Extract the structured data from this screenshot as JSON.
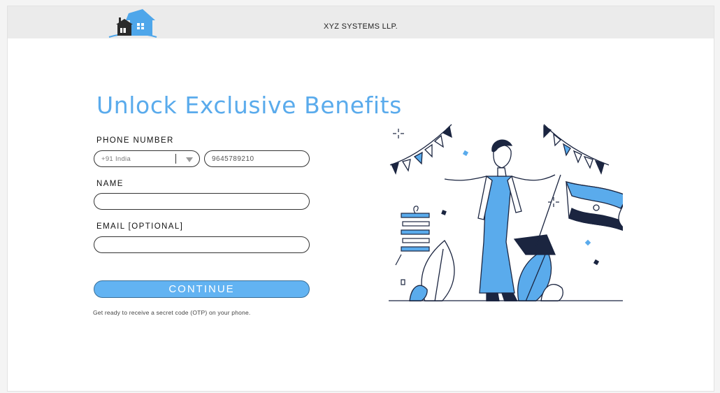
{
  "header": {
    "company_name": "XYZ SYSTEMS LLP.",
    "logo_icon": "house-logo-icon"
  },
  "form": {
    "title": "Unlock Exclusive Benefits",
    "phone_label": "PHONE NUMBER",
    "country_code_value": "+91 India",
    "phone_value": "9645789210",
    "name_label": "NAME",
    "name_value": "",
    "email_label": "EMAIL [OPTIONAL]",
    "email_value": "",
    "continue_label": "CONTINUE",
    "note": "Get ready to receive a secret code (OTP) on your phone."
  },
  "colors": {
    "accent": "#5aabec",
    "button": "#62b3f2",
    "navy": "#1b2540",
    "header_bg": "#ebebeb"
  }
}
